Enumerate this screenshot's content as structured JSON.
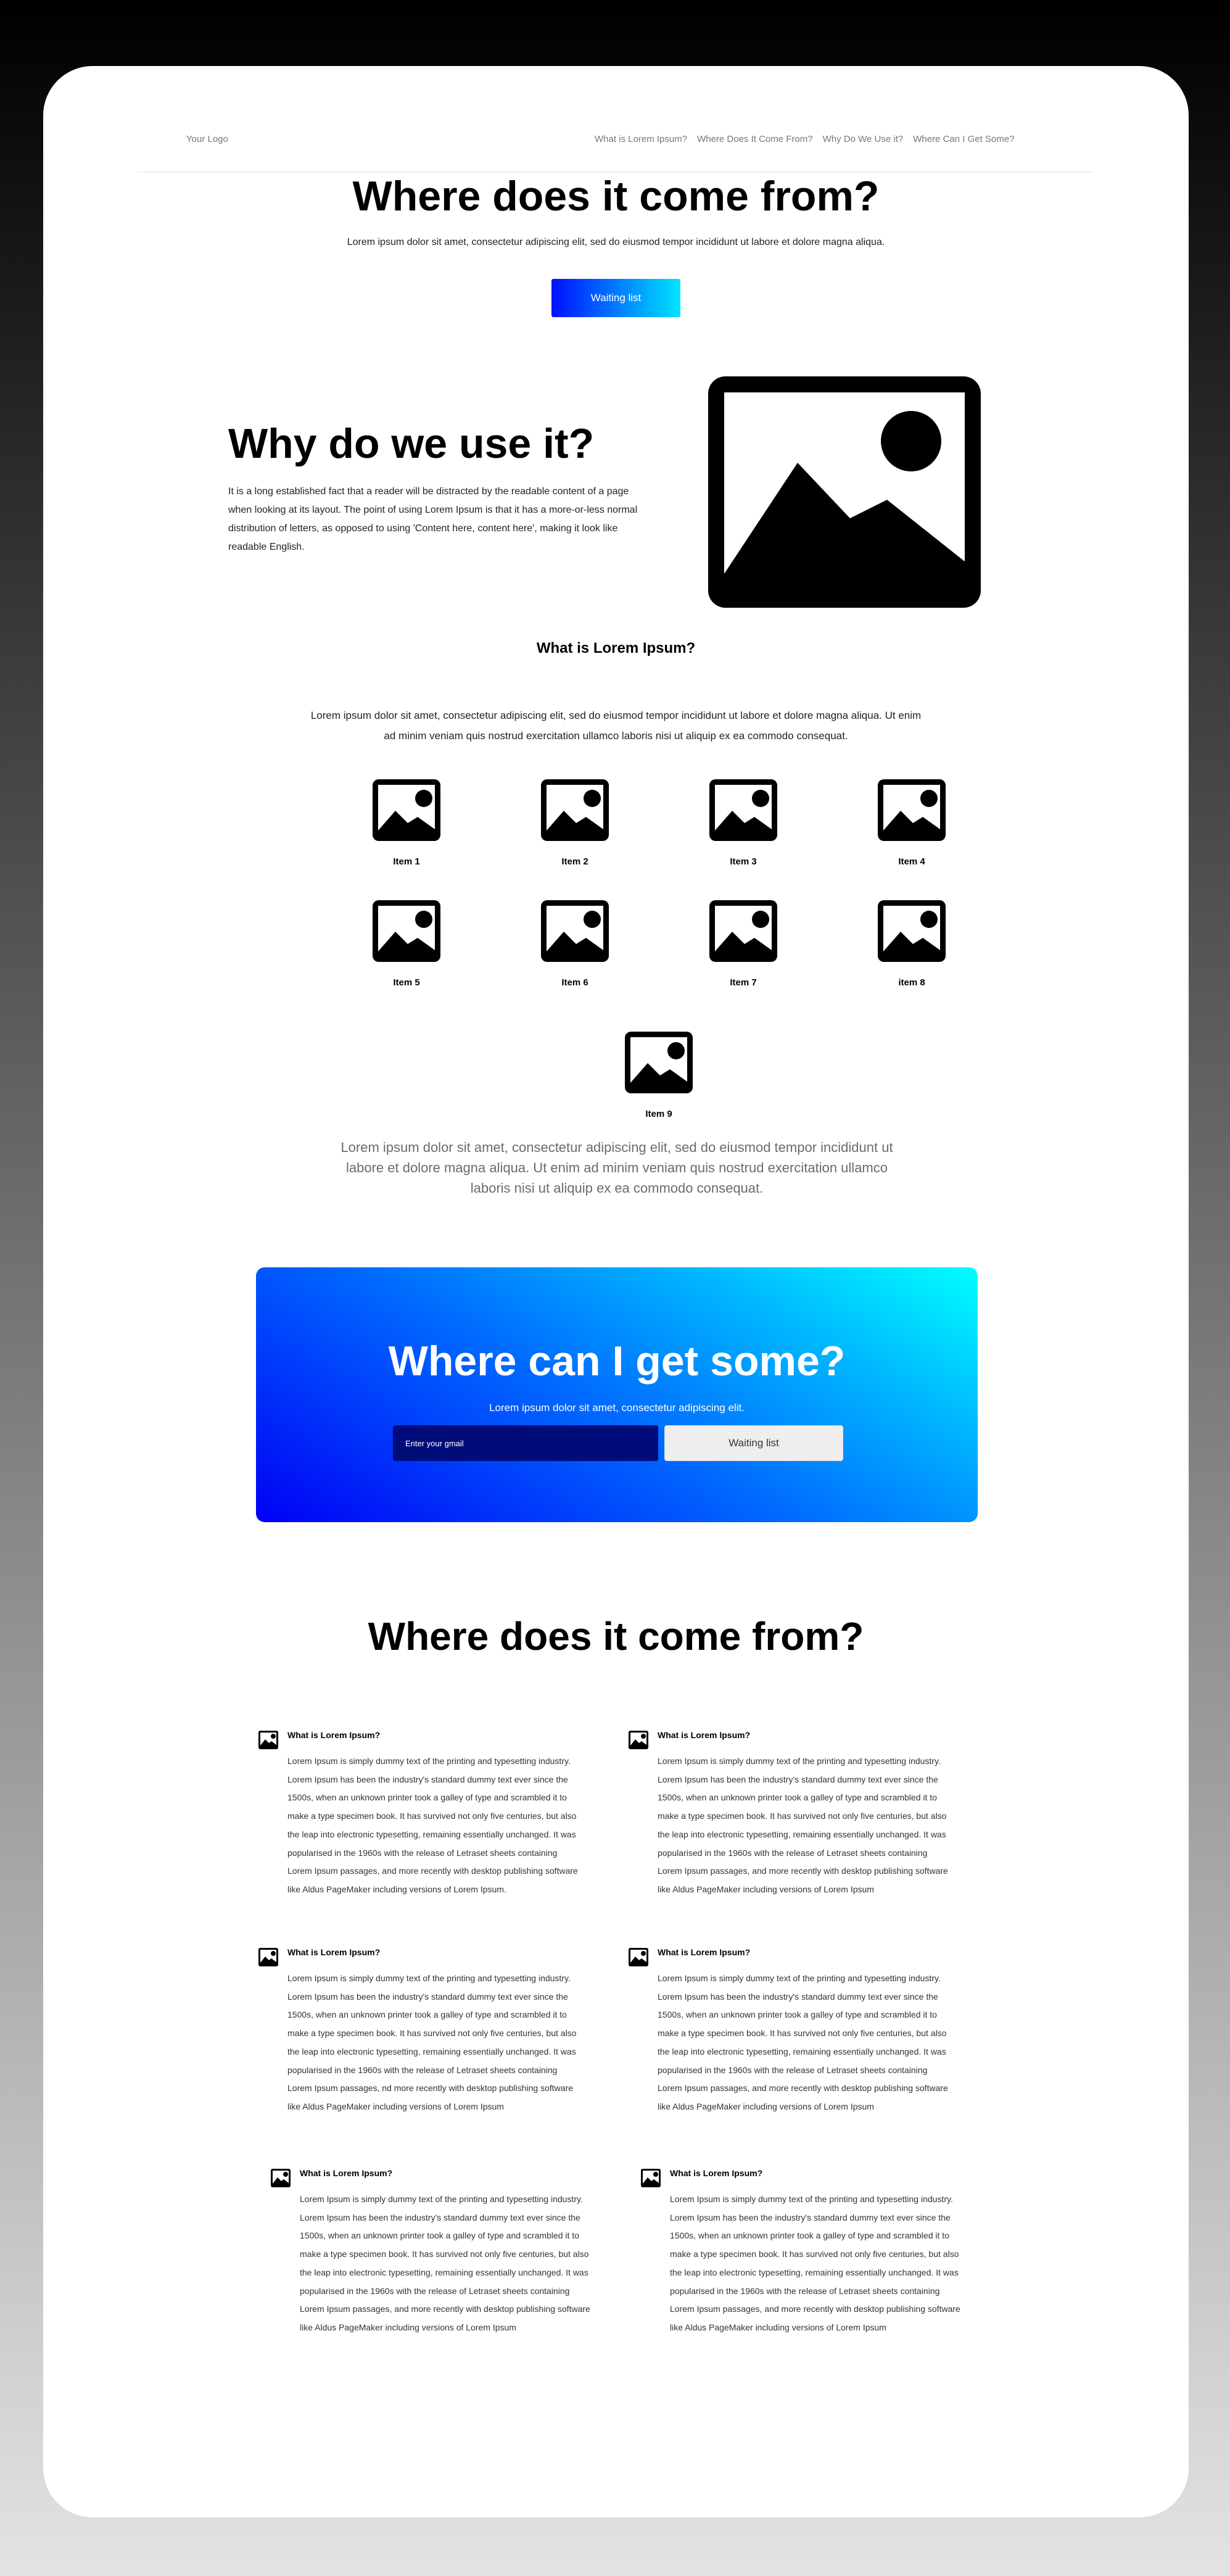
{
  "nav": {
    "logo": "Your Logo",
    "links": [
      "What is Lorem Ipsum?",
      "Where Does It Come From?",
      "Why Do We Use it?",
      "Where Can I Get Some?"
    ]
  },
  "hero": {
    "title": "Where does it come from?",
    "subtitle": "Lorem ipsum dolor sit amet, consectetur adipiscing elit, sed do eiusmod tempor incididunt ut labore et dolore magna aliqua.",
    "button": "Waiting list"
  },
  "why": {
    "title": "Why do we use it?",
    "text": "It is a long established fact that a reader will be distracted by the readable content of a page when looking at its layout. The point of using Lorem Ipsum is that it has a more-or-less normal distribution of letters, as opposed to using 'Content here, content here', making it look like readable English.",
    "image_icon": "image-placeholder-icon"
  },
  "lorem": {
    "title": "What is Lorem Ipsum?",
    "text": "Lorem ipsum dolor sit amet, consectetur adipiscing elit, sed do eiusmod tempor incididunt ut labore et dolore magna aliqua. Ut enim ad minim veniam quis nostrud exercitation ullamco laboris nisi ut aliquip ex ea commodo consequat.",
    "items": [
      "Item 1",
      "Item 2",
      "Item 3",
      "Item 4",
      "Item 5",
      "Item 6",
      "Item 7",
      "item 8",
      "Item 9"
    ],
    "footer_text": "Lorem ipsum dolor sit amet, consectetur adipiscing elit, sed do eiusmod tempor incididunt ut labore et dolore magna aliqua. Ut enim ad minim veniam quis nostrud exercitation ullamco laboris nisi ut aliquip ex ea commodo consequat."
  },
  "cta": {
    "title": "Where can I get some?",
    "subtitle": "Lorem ipsum dolor sit amet, consectetur adipiscing elit.",
    "email_placeholder": "Enter your gmail",
    "button": "Waiting list",
    "gradient_colors": [
      "#0000f5",
      "#00ffff"
    ]
  },
  "features": {
    "title": "Where does it come from?",
    "items": [
      {
        "title": "What is Lorem Ipsum?",
        "text": "Lorem Ipsum is simply dummy text of the printing and typesetting industry. Lorem Ipsum has been the industry's standard dummy text ever since the 1500s, when an unknown printer took a galley of type and scrambled it to make a type specimen book. It has survived not only five centuries, but also the leap into electronic typesetting, remaining essentially unchanged. It was popularised in the 1960s with the release of Letraset sheets containing Lorem Ipsum passages, and more recently with desktop publishing software like Aldus PageMaker including versions of Lorem Ipsum."
      },
      {
        "title": "What is Lorem Ipsum?",
        "text": "Lorem Ipsum is simply dummy text of the printing and typesetting industry. Lorem Ipsum has been the industry's standard dummy text ever since the 1500s, when an unknown printer took a galley of type and scrambled it to make a type specimen book. It has survived not only five centuries, but also the leap into electronic typesetting, remaining essentially unchanged. It was popularised in the 1960s with the release of Letraset sheets containing Lorem Ipsum passages, and more recently with desktop publishing software like Aldus PageMaker including versions of Lorem Ipsum"
      },
      {
        "title": "What is Lorem Ipsum?",
        "text": "Lorem Ipsum is simply dummy text of the printing and typesetting industry. Lorem Ipsum has been the industry's standard dummy text ever since the 1500s, when an unknown printer took a galley of type and scrambled it to make a type specimen book. It has survived not only five centuries, but also the leap into electronic typesetting, remaining essentially unchanged. It was popularised in the 1960s with the release of Letraset sheets containing Lorem Ipsum passages, nd more recently with desktop publishing software like Aldus PageMaker including versions of Lorem Ipsum"
      },
      {
        "title": "What is Lorem Ipsum?",
        "text": "Lorem Ipsum is simply dummy text of the printing and typesetting industry. Lorem Ipsum has been the industry's standard dummy text ever since the 1500s, when an unknown printer took a galley of type and scrambled it to make a type specimen book. It has survived not only five centuries, but also the leap into electronic typesetting, remaining essentially unchanged. It was popularised in the 1960s with the release of Letraset sheets containing Lorem Ipsum passages, and more recently with desktop publishing software like Aldus PageMaker including versions of Lorem Ipsum"
      },
      {
        "title": "What is Lorem Ipsum?",
        "text": "Lorem Ipsum is simply dummy text of the printing and typesetting industry. Lorem Ipsum has been the industry's standard dummy text ever since the 1500s, when an unknown printer took a galley of type and scrambled it to make a type specimen book. It has survived not only five centuries, but also the leap into electronic typesetting, remaining essentially unchanged. It was popularised in the 1960s with the release of Letraset sheets containing Lorem Ipsum passages, and more recently with desktop publishing software like Aldus PageMaker including versions of Lorem Ipsum"
      },
      {
        "title": "What is Lorem Ipsum?",
        "text": "Lorem Ipsum is simply dummy text of the printing and typesetting industry. Lorem Ipsum has been the industry's standard dummy text ever since the 1500s, when an unknown printer took a galley of type and scrambled it to make a type specimen book. It has survived not only five centuries, but also the leap into electronic typesetting, remaining essentially unchanged. It was popularised in the 1960s with the release of Letraset sheets containing Lorem Ipsum passages, and more recently with desktop publishing software like Aldus PageMaker including versions of Lorem Ipsum"
      }
    ]
  }
}
